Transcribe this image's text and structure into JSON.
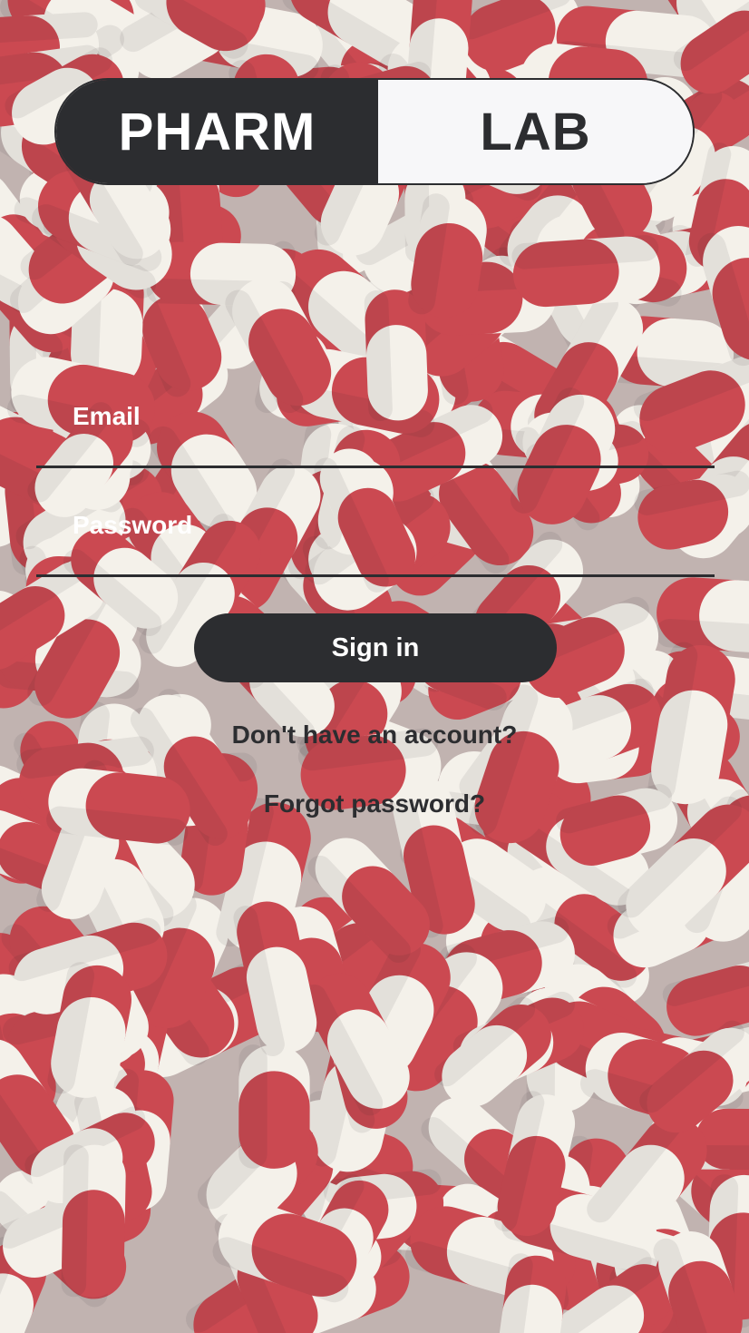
{
  "logo": {
    "left_text": "PHARM",
    "right_text": "LAB"
  },
  "form": {
    "email_placeholder": "Email",
    "email_value": "",
    "password_placeholder": "Password",
    "password_value": "",
    "signin_label": "Sign in"
  },
  "links": {
    "signup": "Don't have an account?",
    "forgot": "Forgot password?"
  },
  "background": {
    "description_icon": "red-white-capsules-photo"
  },
  "colors": {
    "dark": "#2c2d30",
    "light": "#f7f7f9",
    "capsule_red": "#c4303a",
    "capsule_white": "#f3efe8"
  }
}
